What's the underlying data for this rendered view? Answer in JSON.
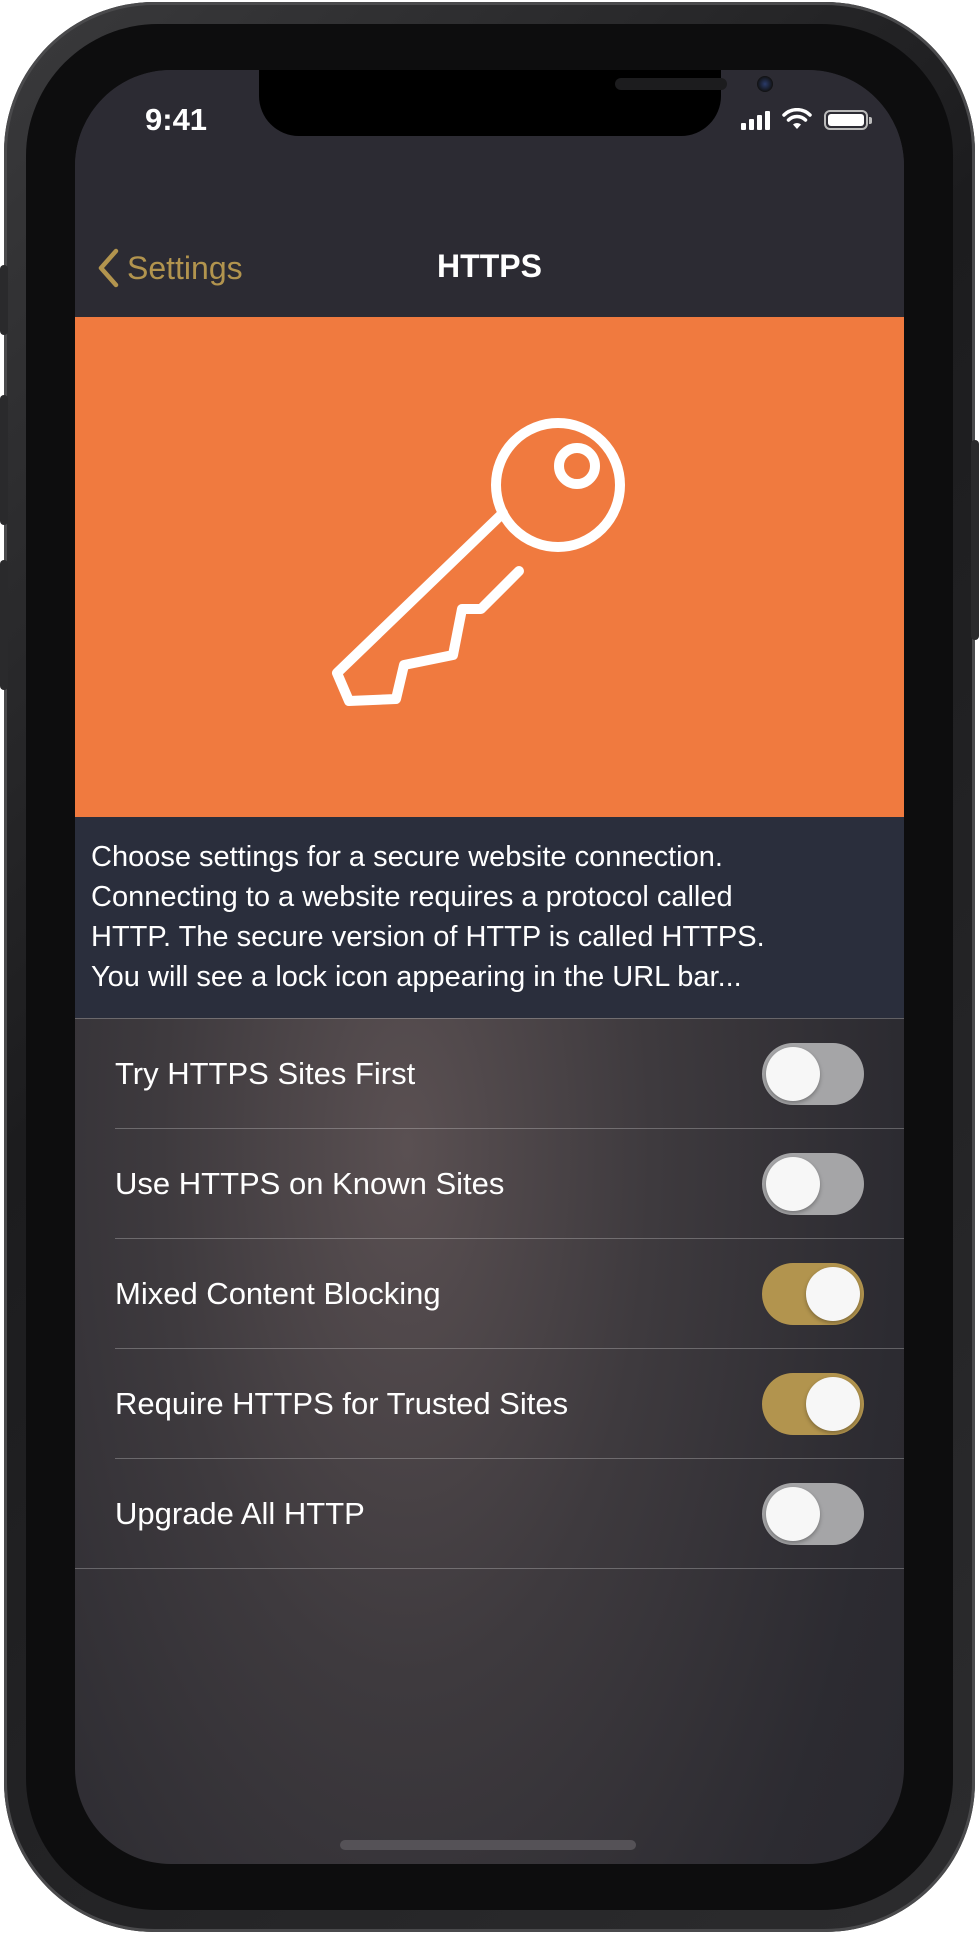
{
  "status_bar": {
    "time": "9:41"
  },
  "nav": {
    "back_label": "Settings",
    "title": "HTTPS"
  },
  "hero": {
    "icon": "key-icon",
    "color": "#f07a3f"
  },
  "description": {
    "lines": [
      "Choose settings for a secure website connection.",
      "Connecting to a website requires a protocol called",
      "HTTP. The secure version of HTTP is called HTTPS.",
      "You will see a lock icon appearing in the URL bar..."
    ]
  },
  "settings": [
    {
      "label": "Try HTTPS Sites First",
      "enabled": false
    },
    {
      "label": "Use HTTPS on Known Sites",
      "enabled": false
    },
    {
      "label": "Mixed Content Blocking",
      "enabled": true
    },
    {
      "label": "Require HTTPS for Trusted Sites",
      "enabled": true
    },
    {
      "label": "Upgrade All HTTP",
      "enabled": false
    }
  ],
  "colors": {
    "accent": "#b2944e",
    "hero": "#f07a3f",
    "toggle_off": "#a5a5a7"
  }
}
